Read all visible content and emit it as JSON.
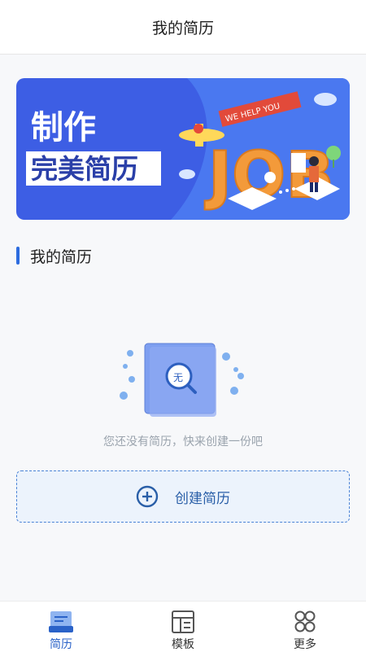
{
  "header": {
    "title": "我的简历"
  },
  "banner": {
    "line1": "制作",
    "line2": "完美简历",
    "tag": "WE HELP YOU",
    "job_text": "JOB"
  },
  "section": {
    "title": "我的简历"
  },
  "empty_state": {
    "icon_text": "无",
    "message": "您还没有简历，快来创建一份吧"
  },
  "create_button": {
    "label": "创建简历"
  },
  "tabbar": {
    "tabs": [
      {
        "label": "简历",
        "icon": "resume-icon",
        "active": true
      },
      {
        "label": "模板",
        "icon": "template-icon",
        "active": false
      },
      {
        "label": "更多",
        "icon": "more-icon",
        "active": false
      }
    ]
  },
  "colors": {
    "accent": "#2d6cdf",
    "banner_bg": "#3f63e6",
    "job_orange": "#f39a3a"
  }
}
